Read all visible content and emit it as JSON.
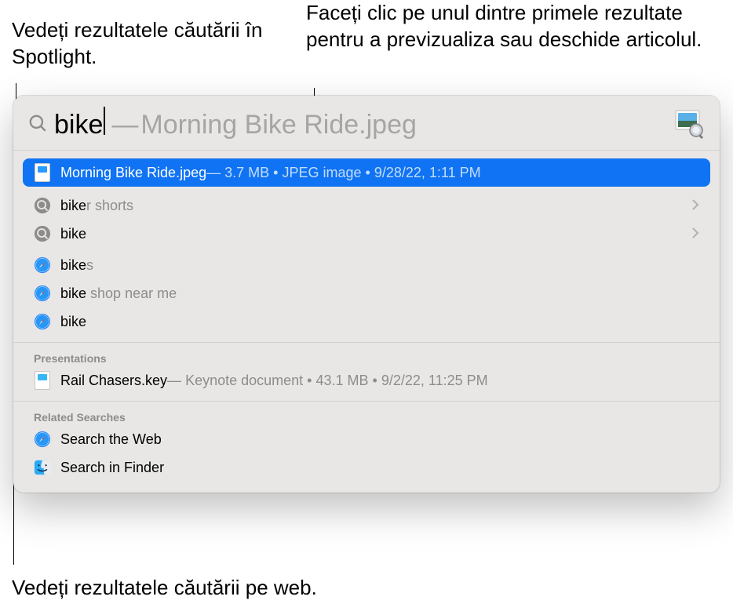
{
  "callouts": {
    "spotlight_results": "Vedeți rezultatele căutării în Spotlight.",
    "preview_click": "Faceți clic pe unul dintre primele rezultate pentru a previzualiza sau deschide articolul.",
    "web_results": "Vedeți rezultatele căutării pe web."
  },
  "search": {
    "query": "bike",
    "suggestion_dash": "—",
    "suggestion": "Morning Bike Ride.jpeg"
  },
  "top_hit": {
    "title": "Morning Bike Ride.jpeg",
    "dash": " — ",
    "size": "3.7 MB",
    "sep": " • ",
    "kind": "JPEG image",
    "date": "9/28/22, 1:11 PM"
  },
  "suggestions": [
    {
      "prefix": "bike",
      "rest": "r shorts"
    },
    {
      "prefix": "bike",
      "rest": ""
    }
  ],
  "web_suggestions": [
    {
      "prefix": "bike",
      "rest": "s"
    },
    {
      "prefix": "bike",
      "rest": " shop near me"
    },
    {
      "prefix": "bike",
      "rest": ""
    }
  ],
  "sections": {
    "presentations": "Presentations",
    "related_searches": "Related Searches"
  },
  "presentations_row": {
    "title": "Rail Chasers.key",
    "dash": " — ",
    "kind": "Keynote document",
    "sep": " • ",
    "size": "43.1 MB",
    "date": "9/2/22, 11:25 PM"
  },
  "related": {
    "search_web": "Search the Web",
    "search_finder": "Search in Finder"
  }
}
